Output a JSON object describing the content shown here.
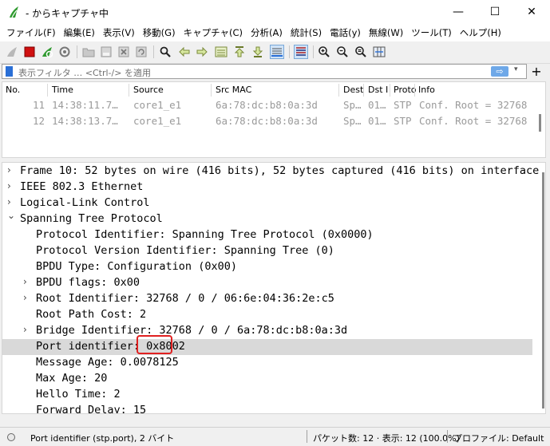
{
  "window": {
    "title": "- からキャプチャ中",
    "minimize_glyph": "—",
    "maximize_glyph": "☐",
    "close_glyph": "✕"
  },
  "menu": [
    "ファイル(F)",
    "編集(E)",
    "表示(V)",
    "移動(G)",
    "キャプチャ(C)",
    "分析(A)",
    "統計(S)",
    "電話(y)",
    "無線(W)",
    "ツール(T)",
    "ヘルプ(H)"
  ],
  "filter": {
    "placeholder": "表示フィルタ … <Ctrl-/> を適用",
    "apply_glyph": "⇨",
    "dropdown_glyph": "▾",
    "add_glyph": "+"
  },
  "packet_list": {
    "columns": [
      "No.",
      "Time",
      "Source",
      "Src MAC",
      "Dest",
      "Dst I",
      "Proto",
      "Info"
    ],
    "rows": [
      {
        "no": "11",
        "time": "14:38:11.7…",
        "source": "core1_e1",
        "src_mac": "6a:78:dc:b8:0a:3d",
        "dest": "Sp…",
        "dst_i": "01…",
        "proto": "STP",
        "info": "Conf. Root = 32768"
      },
      {
        "no": "12",
        "time": "14:38:13.7…",
        "source": "core1_e1",
        "src_mac": "6a:78:dc:b8:0a:3d",
        "dest": "Sp…",
        "dst_i": "01…",
        "proto": "STP",
        "info": "Conf. Root = 32768"
      }
    ]
  },
  "detail_tree": [
    {
      "text": "Frame 10: 52 bytes on wire (416 bits), 52 bytes captured (416 bits) on interface",
      "arrow": "›"
    },
    {
      "text": "IEEE 802.3 Ethernet",
      "arrow": "›"
    },
    {
      "text": "Logical-Link Control",
      "arrow": "›"
    },
    {
      "text": "Spanning Tree Protocol",
      "arrow": "⌄"
    },
    {
      "text": "Protocol Identifier: Spanning Tree Protocol (0x0000)",
      "arrow": ""
    },
    {
      "text": "Protocol Version Identifier: Spanning Tree (0)",
      "arrow": ""
    },
    {
      "text": "BPDU Type: Configuration (0x00)",
      "arrow": ""
    },
    {
      "text": "BPDU flags: 0x00",
      "arrow": "›"
    },
    {
      "text": "Root Identifier: 32768 / 0 / 06:6e:04:36:2e:c5",
      "arrow": "›"
    },
    {
      "text": "Root Path Cost: 2",
      "arrow": ""
    },
    {
      "text": "Bridge Identifier: 32768 / 0 / 6a:78:dc:b8:0a:3d",
      "arrow": "›"
    },
    {
      "text": "Port identifier: 0x8002",
      "arrow": "",
      "selected": true
    },
    {
      "text": "Message Age: 0.0078125",
      "arrow": ""
    },
    {
      "text": "Max Age: 20",
      "arrow": ""
    },
    {
      "text": "Hello Time: 2",
      "arrow": ""
    },
    {
      "text": "Forward Delay: 15",
      "arrow": ""
    }
  ],
  "status": {
    "field": "Port identifier (stp.port), 2 バイト",
    "packets": "パケット数: 12 · 表示: 12 (100.0%)",
    "profile": "プロファイル: Default"
  },
  "colors": {
    "accent": "#2a6fd6",
    "selected_row": "#d9d9d9",
    "highlight": "#e02020",
    "stop_red": "#d01010",
    "shark_fin_green": "#2f9a2f"
  }
}
